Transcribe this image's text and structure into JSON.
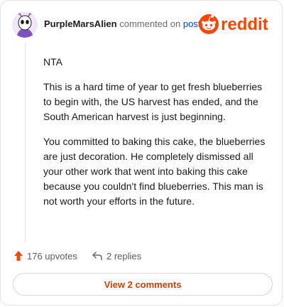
{
  "comment": {
    "username": "PurpleMarsAlien",
    "commented_on_text": "commented on",
    "post_link_text": "post",
    "paragraphs": [
      "NTA",
      "This is a hard time of year to get fresh blueberries to begin with, the US harvest has ended, and the South American harvest is just beginning.",
      "You committed to baking this cake, the blueberries are just decoration. He completely dismissed all your other work that went into baking this cake because you couldn't find blueberries. This man is not worth your efforts in the future."
    ]
  },
  "brand": {
    "logo_text": "reddit",
    "accent_color": "#ff4500"
  },
  "actions": {
    "upvotes_label": "176 upvotes",
    "replies_label": "2 replies"
  },
  "footer": {
    "view_comments_label": "View 2 comments"
  },
  "icons": {
    "avatar": "alien-avatar",
    "logo": "reddit-snoo-icon",
    "upvote": "upvote-arrow-icon",
    "reply": "reply-arrow-icon"
  }
}
